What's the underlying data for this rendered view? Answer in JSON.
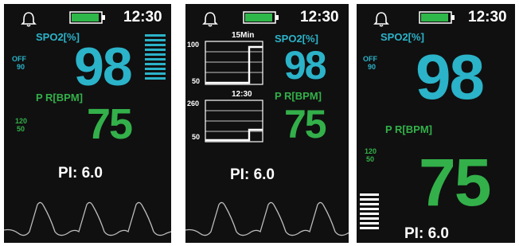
{
  "status_bar": {
    "time": "12:30",
    "bell_icon": "bell-icon",
    "battery_icon": "battery-icon",
    "battery_level": 0.85
  },
  "screens": [
    {
      "spo2": {
        "label": "SPO2[%]",
        "value": "98",
        "alarm_high": "OFF",
        "alarm_low": "90"
      },
      "pr": {
        "label": "P R[BPM]",
        "value": "75",
        "alarm_high": "120",
        "alarm_low": "50"
      },
      "pi": {
        "label": "PI:",
        "value": "6.0"
      },
      "signal_bars": 10
    },
    {
      "spo2": {
        "label": "SPO2[%]",
        "value": "98"
      },
      "pr": {
        "label": "P R[BPM]",
        "value": "75"
      },
      "pi": {
        "label": "PI:",
        "value": "6.0"
      },
      "trend": {
        "spo2_title": "15Min",
        "spo2_axis_top": "100",
        "spo2_axis_bottom": "50",
        "pr_title": "12:30",
        "pr_axis_top": "260",
        "pr_axis_bottom": "50"
      }
    },
    {
      "spo2": {
        "label": "SPO2[%]",
        "value": "98",
        "alarm_high": "OFF",
        "alarm_low": "90"
      },
      "pr": {
        "label": "P R[BPM]",
        "value": "75",
        "alarm_high": "120",
        "alarm_low": "50"
      },
      "pi": {
        "label": "PI:",
        "value": "6.0"
      },
      "signal_bars": 8
    }
  ],
  "colors": {
    "spo2": "#2bb3c9",
    "pr": "#33b04a",
    "battery": "#2fb84a",
    "background": "#101010"
  }
}
